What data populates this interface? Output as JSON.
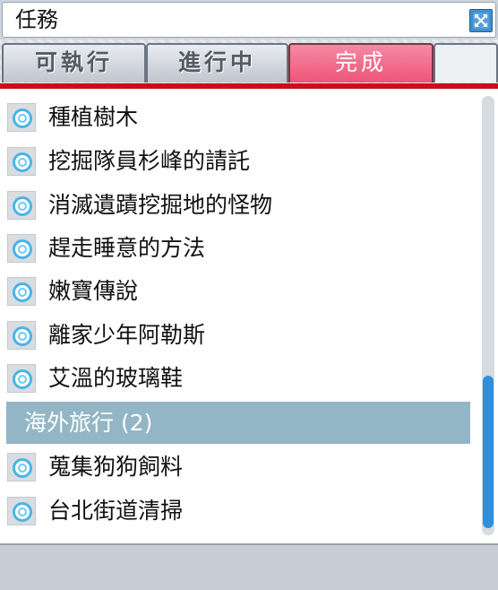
{
  "window": {
    "title": "任務",
    "close_icon": "close-icon"
  },
  "tabs": [
    {
      "label": "可執行",
      "active": false
    },
    {
      "label": "進行中",
      "active": false
    },
    {
      "label": "完成",
      "active": true
    }
  ],
  "colors": {
    "active_tab": "#ee5479",
    "divider": "#c8101c",
    "group_header": "#93b6c6",
    "scroll_thumb": "#2f8fdd",
    "quest_icon": "#47b5e8"
  },
  "quests": {
    "items_before_group": [
      {
        "label": "種植樹木",
        "icon": "quest-ring-icon"
      },
      {
        "label": "挖掘隊員杉峰的請託",
        "icon": "quest-ring-icon"
      },
      {
        "label": "消滅遺蹟挖掘地的怪物",
        "icon": "quest-ring-icon"
      },
      {
        "label": "趕走睡意的方法",
        "icon": "quest-ring-icon"
      },
      {
        "label": "嫩寶傳說",
        "icon": "quest-ring-icon"
      },
      {
        "label": "離家少年阿勒斯",
        "icon": "quest-ring-icon"
      },
      {
        "label": "艾溫的玻璃鞋",
        "icon": "quest-ring-icon"
      }
    ],
    "group": {
      "label": "海外旅行 (2)"
    },
    "items_after_group": [
      {
        "label": "蒐集狗狗飼料",
        "icon": "quest-ring-icon"
      },
      {
        "label": "台北街道清掃",
        "icon": "quest-ring-icon"
      }
    ]
  }
}
